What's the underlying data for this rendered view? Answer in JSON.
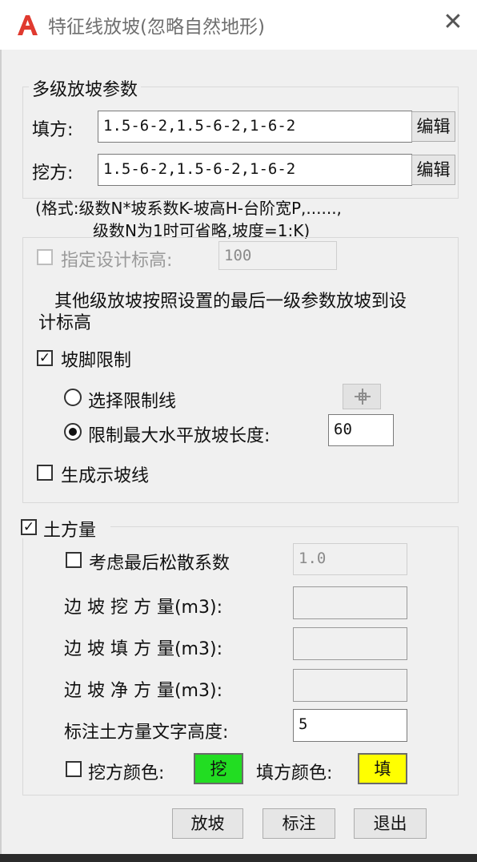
{
  "window": {
    "title": "特征线放坡(忽略自然地形)",
    "close_glyph": "✕",
    "logo_color": "#e03a2f"
  },
  "multi_slope": {
    "legend": "多级放坡参数",
    "fill": {
      "label": "填方:",
      "value": "1.5-6-2,1.5-6-2,1-6-2",
      "edit_label": "编辑"
    },
    "cut": {
      "label": "挖方:",
      "value": "1.5-6-2,1.5-6-2,1-6-2",
      "edit_label": "编辑"
    },
    "format_line1": "(格式:级数N*坡系数K-坡高H-台阶宽P,......,",
    "format_line2": "级数N为1时可省略,坡度=1:K)"
  },
  "design_elev": {
    "checkbox_label": "指定设计标高:",
    "checked": false,
    "value": "100",
    "note_line1": "其他级放坡按照设置的最后一级参数放坡到设",
    "note_line2": "计标高"
  },
  "toe_limit": {
    "checkbox_label": "坡脚限制",
    "checked": true,
    "options": [
      {
        "label": "选择限制线",
        "selected": false
      },
      {
        "label": "限制最大水平放坡长度:",
        "selected": true
      }
    ],
    "max_length_value": "60",
    "pick_icon": "crosshair-pick"
  },
  "slope_line": {
    "checkbox_label": "生成示坡线",
    "checked": false
  },
  "earthwork": {
    "legend": "土方量",
    "checked": true,
    "loose_factor": {
      "label": "考虑最后松散系数",
      "checked": false,
      "value": "1.0"
    },
    "cut_volume_label": "边 坡 挖 方 量(m3):",
    "cut_volume_value": "",
    "fill_volume_label": "边 坡 填 方 量(m3):",
    "fill_volume_value": "",
    "net_volume_label": "边 坡 净 方 量(m3):",
    "net_volume_value": "",
    "text_height_label": "标注土方量文字高度:",
    "text_height_value": "5",
    "cut_color_checkbox_label": "挖方颜色:",
    "cut_color_checked": false,
    "cut_color_swatch_label": "挖",
    "cut_color": "#22dd22",
    "fill_color_label": "填方颜色:",
    "fill_color_swatch_label": "填",
    "fill_color": "#ffff00"
  },
  "buttons": {
    "slope": "放坡",
    "annotate": "标注",
    "exit": "退出"
  }
}
